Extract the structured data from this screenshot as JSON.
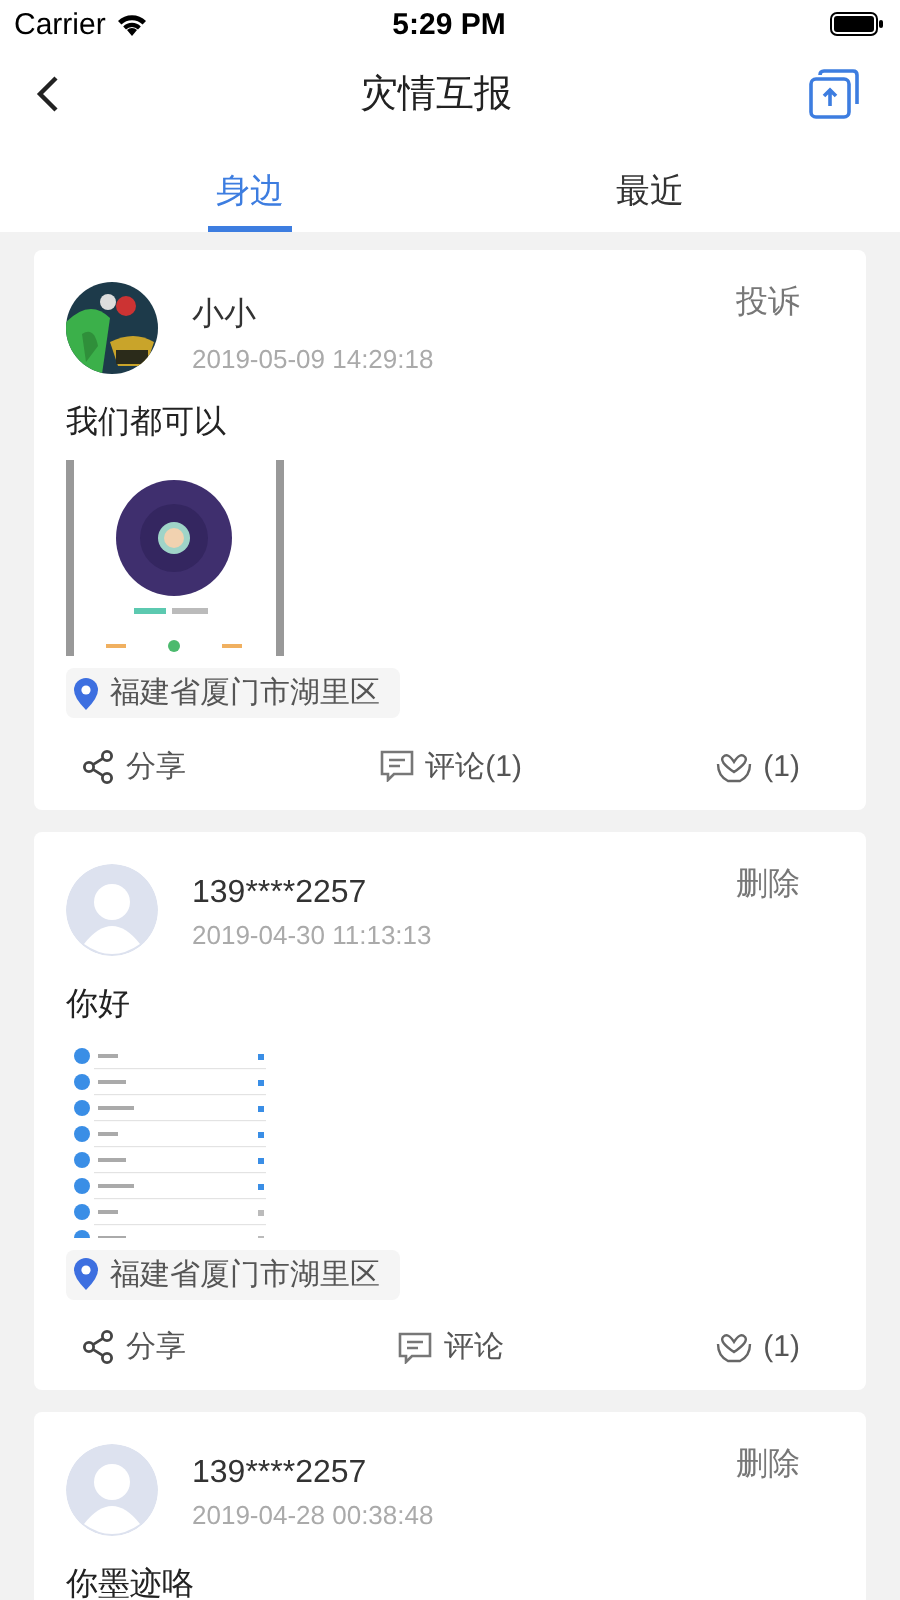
{
  "status_bar": {
    "carrier": "Carrier",
    "time": "5:29 PM"
  },
  "nav": {
    "title": "灾情互报"
  },
  "tabs": [
    {
      "label": "身边",
      "selected": true
    },
    {
      "label": "最近",
      "selected": false
    }
  ],
  "posts": [
    {
      "name": "小小",
      "time": "2019-05-09 14:29:18",
      "action": "投诉",
      "text": "我们都可以",
      "location": "福建省厦门市湖里区",
      "share": "分享",
      "comment": "评论(1)",
      "likes": "(1)"
    },
    {
      "avatar": {
        "kind": "default"
      },
      "name": "139****2257",
      "time": "2019-04-30 11:13:13",
      "action": "删除",
      "text": "你好",
      "location": "福建省厦门市湖里区",
      "share": "分享",
      "comment": "评论",
      "likes": "(1)"
    },
    {
      "avatar": {
        "kind": "default"
      },
      "name": "139****2257",
      "time": "2019-04-28 00:38:48",
      "action": "删除",
      "text": "你墨迹咯"
    }
  ]
}
